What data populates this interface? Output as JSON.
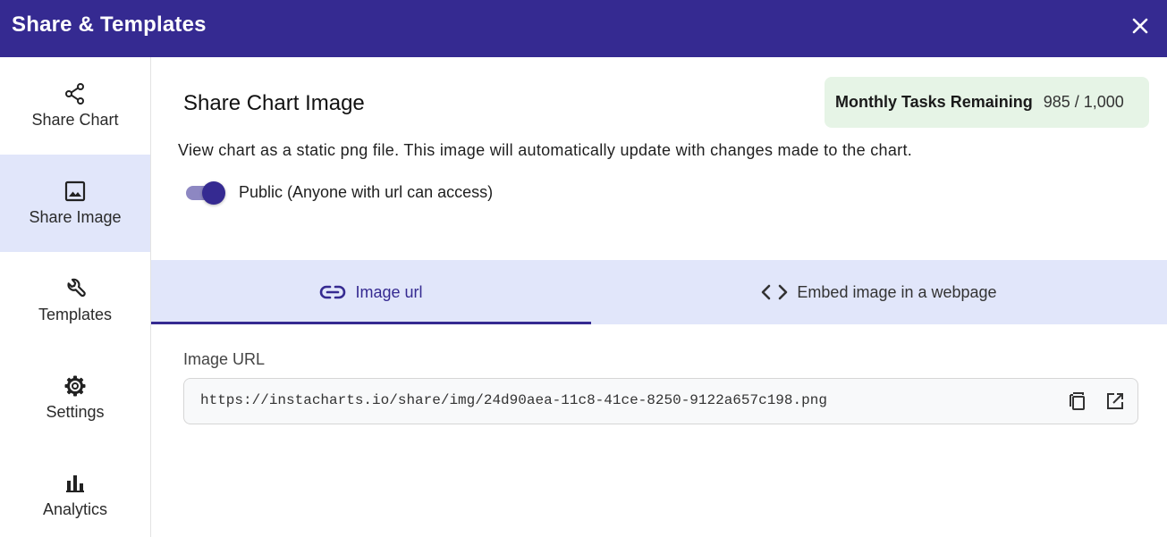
{
  "header": {
    "title": "Share & Templates",
    "close_icon": "close-icon"
  },
  "sidebar": {
    "items": [
      {
        "label": "Share Chart",
        "icon": "share-icon",
        "active": false
      },
      {
        "label": "Share Image",
        "icon": "image-icon",
        "active": true
      },
      {
        "label": "Templates",
        "icon": "wrench-icon",
        "active": false
      },
      {
        "label": "Settings",
        "icon": "gear-icon",
        "active": false
      },
      {
        "label": "Analytics",
        "icon": "bar-chart-icon",
        "active": false
      }
    ]
  },
  "main": {
    "title": "Share Chart Image",
    "tasks": {
      "label": "Monthly Tasks Remaining",
      "value": "985 / 1,000"
    },
    "description": "View chart as a static png file. This image will automatically update with changes made to the chart.",
    "public_toggle": {
      "label": "Public (Anyone with url can access)",
      "on": true
    },
    "tabs": [
      {
        "label": "Image url",
        "icon": "link-icon",
        "active": true
      },
      {
        "label": "Embed image in a webpage",
        "icon": "code-icon",
        "active": false
      }
    ],
    "url_field": {
      "label": "Image URL",
      "value": "https://instacharts.io/share/img/24d90aea-11c8-41ce-8250-9122a657c198.png",
      "copy_icon": "copy-icon",
      "open_icon": "open-external-icon"
    }
  },
  "colors": {
    "header": "#352a91",
    "active_bg": "#e1e6fa",
    "badge_bg": "#e6f4e6",
    "accent": "#352a91"
  }
}
